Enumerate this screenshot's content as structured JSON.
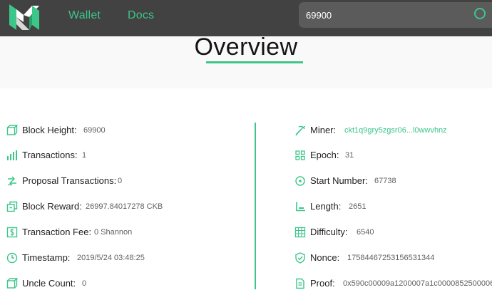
{
  "nav": {
    "wallet_label": "Wallet",
    "docs_label": "Docs",
    "search_value": "69900"
  },
  "overview": {
    "title": "Overview"
  },
  "left_items": [
    {
      "icon": "block-height-icon",
      "label": "Block Height:",
      "value": "69900"
    },
    {
      "icon": "transactions-icon",
      "label": "Transactions:",
      "value": "1"
    },
    {
      "icon": "proposal-transactions-icon",
      "label": "Proposal Transactions:",
      "value": "0"
    },
    {
      "icon": "block-reward-icon",
      "label": "Block Reward:",
      "value": "26997.84017278 CKB"
    },
    {
      "icon": "transaction-fee-icon",
      "label": "Transaction Fee:",
      "value": "0 Shannon"
    },
    {
      "icon": "timestamp-icon",
      "label": "Timestamp:",
      "value": "2019/5/24 03:48:25"
    },
    {
      "icon": "uncle-count-icon",
      "label": "Uncle Count:",
      "value": "0"
    }
  ],
  "right_items": [
    {
      "icon": "miner-icon",
      "label": "Miner:",
      "value": "ckt1q9gry5zgsr06...l0wwvhnz"
    },
    {
      "icon": "epoch-icon",
      "label": "Epoch:",
      "value": "31"
    },
    {
      "icon": "start-number-icon",
      "label": "Start Number:",
      "value": "67738"
    },
    {
      "icon": "length-icon",
      "label": "Length:",
      "value": "2651"
    },
    {
      "icon": "difficulty-icon",
      "label": "Difficulty:",
      "value": "6540"
    },
    {
      "icon": "nonce-icon",
      "label": "Nonce:",
      "value": "17584467253156531344"
    },
    {
      "icon": "proof-icon",
      "label": "Proof:",
      "value": "0x590c00009a1200007a1c0000852500006"
    }
  ],
  "colors": {
    "accent": "#3cc68a",
    "nav_bg": "#424242",
    "banner_bg": "#f9f9f9"
  }
}
